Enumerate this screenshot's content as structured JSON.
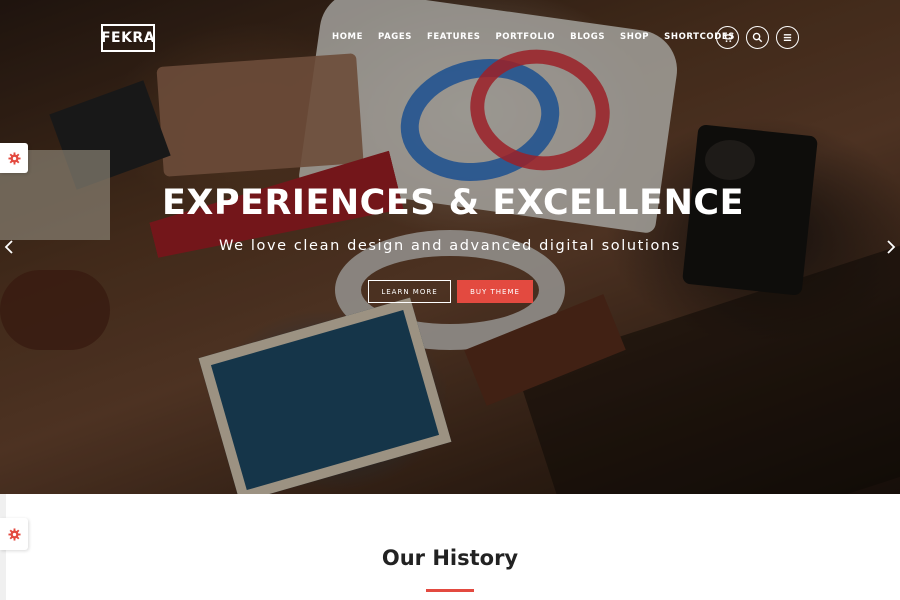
{
  "brand": {
    "logo": "FEKRA"
  },
  "nav": {
    "items": [
      {
        "label": "HOME"
      },
      {
        "label": "PAGES"
      },
      {
        "label": "FEATURES"
      },
      {
        "label": "PORTFOLIO"
      },
      {
        "label": "BLOGS"
      },
      {
        "label": "SHOP"
      },
      {
        "label": "SHORTCODES"
      }
    ],
    "icons": {
      "cart": "cart-icon",
      "search": "search-icon",
      "menu": "menu-icon"
    }
  },
  "hero": {
    "title": "EXPERIENCES & EXCELLENCE",
    "subtitle": "We love clean design and advanced digital solutions",
    "primary_button": "LEARN MORE",
    "secondary_button": "BUY THEME",
    "prev_icon": "chevron-left-icon",
    "next_icon": "chevron-right-icon"
  },
  "sidebar": {
    "settings_icon": "gear-icon"
  },
  "section": {
    "title": "Our History"
  },
  "colors": {
    "accent": "#e34a40",
    "text_dark": "#222222",
    "white": "#ffffff"
  }
}
